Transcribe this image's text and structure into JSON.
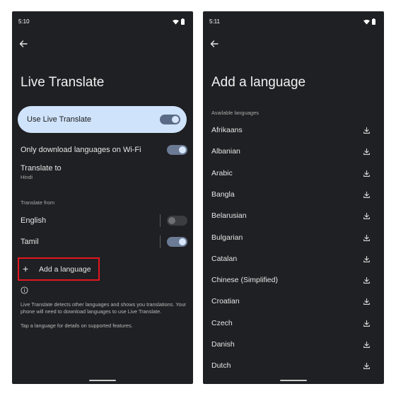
{
  "left": {
    "status_time": "5:10",
    "title": "Live Translate",
    "use_live_translate": {
      "label": "Use Live Translate",
      "enabled": true
    },
    "wifi_only": {
      "label": "Only download languages on Wi-Fi",
      "enabled": true
    },
    "translate_to": {
      "label": "Translate to",
      "value": "Hindi"
    },
    "translate_from_header": "Translate from",
    "from_languages": [
      {
        "name": "English",
        "enabled": false
      },
      {
        "name": "Tamil",
        "enabled": true
      }
    ],
    "add_language_label": "Add a language",
    "info_text": "Live Translate detects other languages and shows you translations. Your phone will need to download languages to use Live Translate.",
    "tap_hint": "Tap a language for details on supported features."
  },
  "right": {
    "status_time": "5:11",
    "title": "Add a language",
    "available_header": "Available languages",
    "languages": [
      "Afrikaans",
      "Albanian",
      "Arabic",
      "Bangla",
      "Belarusian",
      "Bulgarian",
      "Catalan",
      "Chinese (Simplified)",
      "Croatian",
      "Czech",
      "Danish",
      "Dutch"
    ]
  },
  "icons": {
    "back": "arrow-left-icon",
    "wifi": "wifi-icon",
    "battery": "battery-icon",
    "add": "plus-icon",
    "info": "info-icon",
    "download": "download-icon"
  },
  "colors": {
    "screen_background": "#1f2023",
    "card_background": "#cfe3fb",
    "highlight_border": "#e4161f",
    "switch_on": "#6b7b95"
  }
}
